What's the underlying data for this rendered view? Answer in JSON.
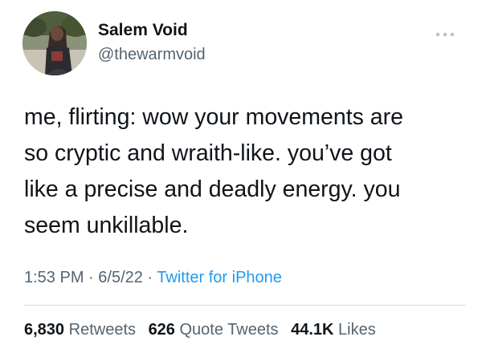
{
  "user": {
    "display_name": "Salem Void",
    "handle": "@thewarmvoid"
  },
  "icons": {
    "avatar": "profile-photo",
    "more": "more-dots-icon"
  },
  "tweet": {
    "lines": [
      "me, flirting: wow your movements are",
      "so cryptic and wraith-like. you’ve got",
      "like a precise and deadly energy. you",
      "seem unkillable."
    ]
  },
  "meta": {
    "time": "1:53 PM",
    "sep1": " · ",
    "date": "6/5/22",
    "sep2": " · ",
    "source": "Twitter for iPhone"
  },
  "stats": {
    "retweets_count": "6,830",
    "retweets_label": "Retweets",
    "quotes_count": "626",
    "quotes_label": "Quote Tweets",
    "likes_count": "44.1K",
    "likes_label": "Likes"
  },
  "colors": {
    "text": "#0f1419",
    "secondary": "#536471",
    "link": "#1d9bf0",
    "divider": "#d6dde3"
  }
}
